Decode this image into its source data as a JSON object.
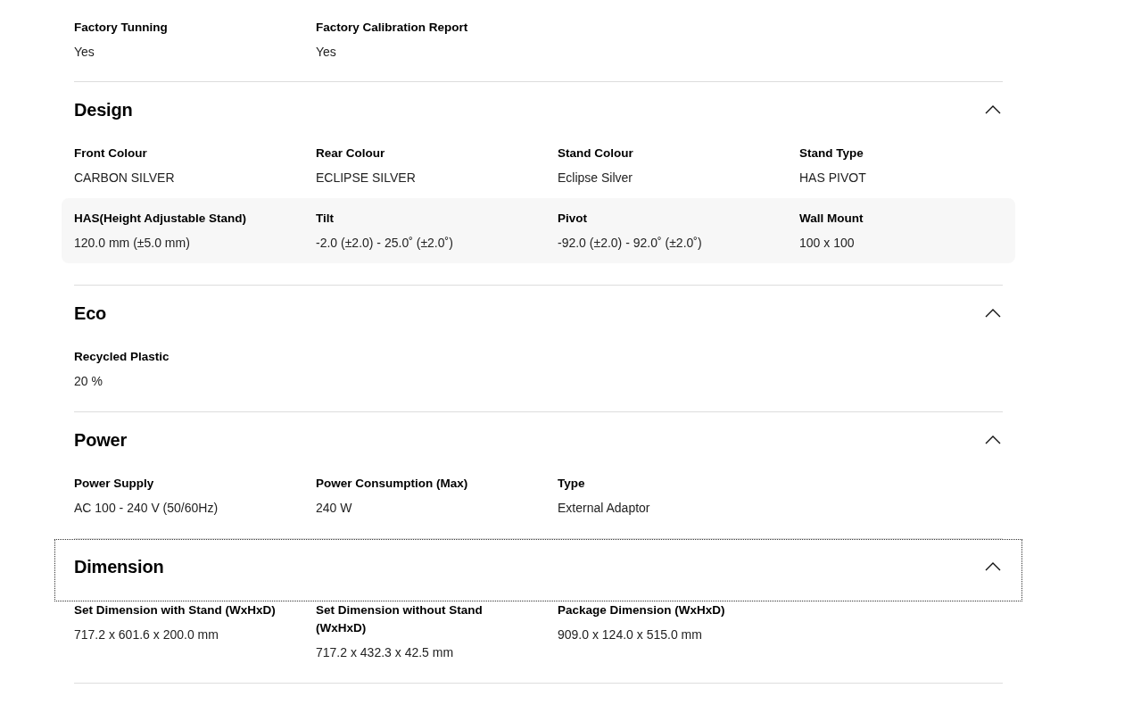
{
  "sections": [
    {
      "rows": [
        {
          "highlighted": false,
          "specs": [
            {
              "label": "Factory Tunning",
              "value": "Yes"
            },
            {
              "label": "Factory Calibration Report",
              "value": "Yes"
            }
          ]
        }
      ]
    },
    {
      "title": "Design",
      "expanded": true,
      "focused": false,
      "rows": [
        {
          "highlighted": false,
          "specs": [
            {
              "label": "Front Colour",
              "value": "CARBON SILVER"
            },
            {
              "label": "Rear Colour",
              "value": "ECLIPSE SILVER"
            },
            {
              "label": "Stand Colour",
              "value": "Eclipse Silver"
            },
            {
              "label": "Stand Type",
              "value": "HAS PIVOT"
            }
          ]
        },
        {
          "highlighted": true,
          "specs": [
            {
              "label": "HAS(Height Adjustable Stand)",
              "value": "120.0 mm (±5.0 mm)"
            },
            {
              "label": "Tilt",
              "value": "-2.0 (±2.0) - 25.0˚ (±2.0˚)"
            },
            {
              "label": "Pivot",
              "value": "-92.0 (±2.0) - 92.0˚ (±2.0˚)"
            },
            {
              "label": "Wall Mount",
              "value": "100 x 100"
            }
          ]
        }
      ]
    },
    {
      "title": "Eco",
      "expanded": true,
      "focused": false,
      "rows": [
        {
          "highlighted": false,
          "specs": [
            {
              "label": "Recycled Plastic",
              "value": "20 %"
            }
          ]
        }
      ]
    },
    {
      "title": "Power",
      "expanded": true,
      "focused": false,
      "rows": [
        {
          "highlighted": false,
          "specs": [
            {
              "label": "Power Supply",
              "value": "AC 100 - 240 V (50/60Hz)"
            },
            {
              "label": "Power Consumption (Max)",
              "value": "240 W"
            },
            {
              "label": "Type",
              "value": "External Adaptor"
            }
          ]
        }
      ]
    },
    {
      "title": "Dimension",
      "expanded": true,
      "focused": true,
      "rows": [
        {
          "highlighted": false,
          "specs": [
            {
              "label": "Set Dimension with Stand (WxHxD)",
              "value": "717.2 x 601.6 x 200.0 mm"
            },
            {
              "label": "Set Dimension without Stand (WxHxD)",
              "value": "717.2 x 432.3 x 42.5 mm"
            },
            {
              "label": "Package Dimension (WxHxD)",
              "value": "909.0 x 124.0 x 515.0 mm"
            }
          ]
        }
      ]
    }
  ]
}
